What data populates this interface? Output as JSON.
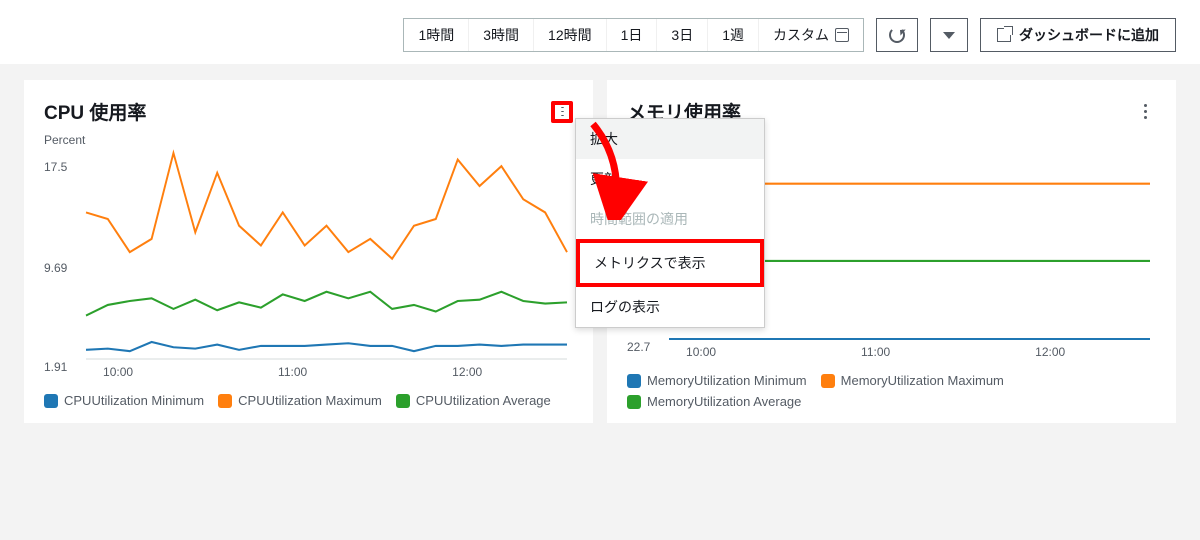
{
  "toolbar": {
    "time_ranges": [
      "1時間",
      "3時間",
      "12時間",
      "1日",
      "3日",
      "1週",
      "カスタム"
    ],
    "add_to_dashboard": "ダッシュボードに追加"
  },
  "dropdown": {
    "items": [
      {
        "label": "拡大",
        "state": "highlighted"
      },
      {
        "label": "更新",
        "state": "normal"
      },
      {
        "label": "時間範囲の適用",
        "state": "disabled"
      },
      {
        "label": "メトリクスで表示",
        "state": "boxed"
      },
      {
        "label": "ログの表示",
        "state": "normal"
      }
    ]
  },
  "panels": {
    "cpu": {
      "title": "CPU 使用率",
      "ylabel": "Percent",
      "yticks": [
        "17.5",
        "9.69",
        "1.91"
      ],
      "xticks": [
        "10:00",
        "11:00",
        "12:00"
      ],
      "legend": [
        {
          "label": "CPUUtilization Minimum",
          "color": "#1f77b4"
        },
        {
          "label": "CPUUtilization Maximum",
          "color": "#ff7f0e"
        },
        {
          "label": "CPUUtilization Average",
          "color": "#2ca02c"
        }
      ]
    },
    "mem": {
      "title": "メモリ使用率",
      "ylabel": "",
      "yticks": [
        "22.7"
      ],
      "xticks": [
        "10:00",
        "11:00",
        "12:00"
      ],
      "legend": [
        {
          "label": "MemoryUtilization Minimum",
          "color": "#1f77b4"
        },
        {
          "label": "MemoryUtilization Maximum",
          "color": "#ff7f0e"
        },
        {
          "label": "MemoryUtilization Average",
          "color": "#2ca02c"
        }
      ]
    }
  },
  "colors": {
    "min": "#1f77b4",
    "max": "#ff7f0e",
    "avg": "#2ca02c",
    "annot": "#ff0000"
  },
  "chart_data": [
    {
      "id": "cpu",
      "type": "line",
      "title": "CPU 使用率",
      "xlabel": "",
      "ylabel": "Percent",
      "ylim": [
        1.91,
        17.5
      ],
      "x": [
        "10:00",
        "10:10",
        "10:20",
        "10:30",
        "10:40",
        "10:50",
        "11:00",
        "11:10",
        "11:20",
        "11:30",
        "11:40",
        "11:50",
        "12:00",
        "12:10",
        "12:20",
        "12:30",
        "12:40",
        "12:50"
      ],
      "series": [
        {
          "name": "CPUUtilization Maximum",
          "color": "#ff7f0e",
          "values": [
            13,
            12.5,
            10,
            11,
            17.5,
            11.5,
            16,
            12,
            10.5,
            13,
            10.5,
            12,
            10,
            11,
            9.5,
            12,
            12.5,
            17,
            15,
            16.5,
            14,
            13,
            10
          ]
        },
        {
          "name": "CPUUtilization Average",
          "color": "#2ca02c",
          "values": [
            5.2,
            6.0,
            6.3,
            6.5,
            5.7,
            6.4,
            5.6,
            6.2,
            5.8,
            6.8,
            6.3,
            7.0,
            6.5,
            7.0,
            5.7,
            6.0,
            5.5,
            6.3,
            6.4,
            7.0,
            6.3,
            6.1,
            6.2
          ]
        },
        {
          "name": "CPUUtilization Minimum",
          "color": "#1f77b4",
          "values": [
            2.6,
            2.7,
            2.5,
            3.2,
            2.8,
            2.7,
            3.0,
            2.6,
            2.9,
            2.9,
            2.9,
            3.0,
            3.1,
            2.9,
            2.9,
            2.5,
            2.9,
            2.9,
            3.0,
            2.9,
            3.0,
            3.0,
            3.0
          ]
        }
      ]
    },
    {
      "id": "mem",
      "type": "line",
      "title": "メモリ使用率",
      "xlabel": "",
      "ylabel": "",
      "ylim": [
        22.7,
        100
      ],
      "x": [
        "10:00",
        "10:10",
        "10:20",
        "10:30",
        "10:40",
        "10:50",
        "11:00",
        "11:10",
        "11:20",
        "11:30",
        "11:40",
        "11:50",
        "12:00",
        "12:10",
        "12:20",
        "12:30",
        "12:40",
        "12:50"
      ],
      "series": [
        {
          "name": "MemoryUtilization Maximum",
          "color": "#ff7f0e",
          "values": [
            81,
            81,
            81,
            81,
            81,
            81,
            81,
            81,
            81,
            81,
            81,
            81,
            81,
            81,
            81,
            81,
            81,
            81
          ]
        },
        {
          "name": "MemoryUtilization Average",
          "color": "#2ca02c",
          "values": [
            52,
            52,
            52,
            52,
            52,
            52,
            52,
            52,
            52,
            52,
            52,
            52,
            52,
            52,
            52,
            52,
            52,
            52
          ]
        },
        {
          "name": "MemoryUtilization Minimum",
          "color": "#1f77b4",
          "values": [
            22.7,
            22.7,
            22.7,
            22.7,
            22.7,
            22.7,
            22.7,
            22.7,
            22.7,
            22.7,
            22.7,
            22.7,
            22.7,
            22.7,
            22.7,
            22.7,
            22.7,
            22.7
          ]
        }
      ]
    }
  ]
}
